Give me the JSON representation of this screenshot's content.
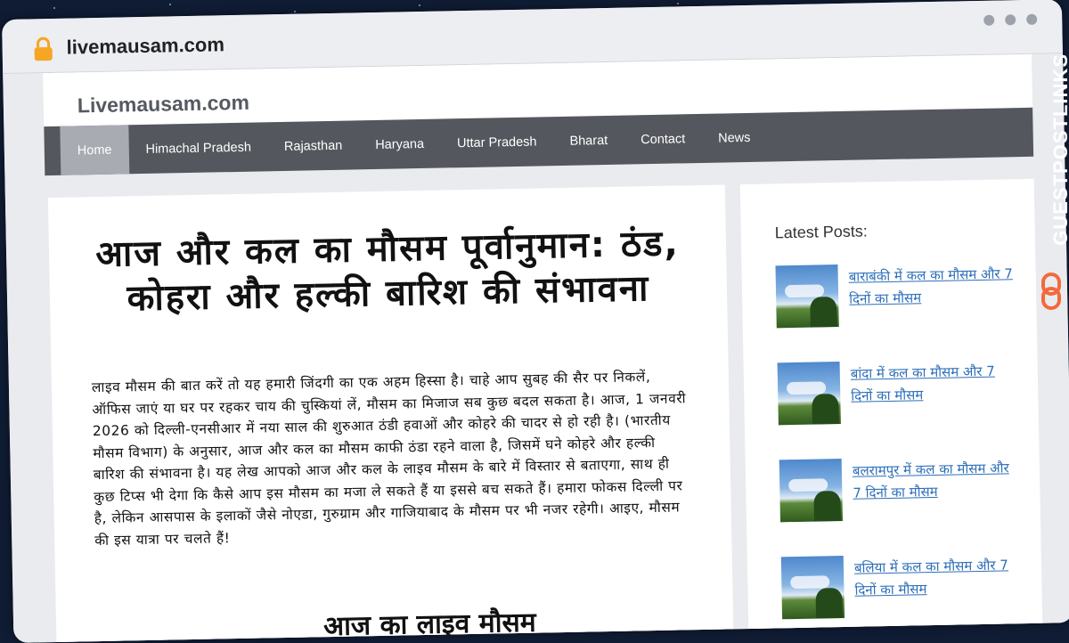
{
  "browser": {
    "url": "livemausam.com"
  },
  "site": {
    "title": "Livemausam.com"
  },
  "nav": {
    "items": [
      "Home",
      "Himachal Pradesh",
      "Rajasthan",
      "Haryana",
      "Uttar Pradesh",
      "Bharat",
      "Contact",
      "News"
    ],
    "active": "Home"
  },
  "post": {
    "title": "आज और कल का मौसम पूर्वानुमान: ठंड, कोहरा और हल्की बारिश की संभावना",
    "body": "लाइव मौसम की बात करें तो यह हमारी जिंदगी का एक अहम हिस्सा है। चाहे आप सुबह की सैर पर निकलें, ऑफिस जाएं या घर पर रहकर चाय की चुस्कियां लें, मौसम का मिजाज सब कुछ बदल सकता है। आज, 1 जनवरी 2026 को दिल्ली-एनसीआर में नया साल की शुरुआत ठंडी हवाओं और कोहरे की चादर से हो रही है। (भारतीय मौसम विभाग) के अनुसार, आज और कल का मौसम काफी ठंडा रहने वाला है, जिसमें घने कोहरे और हल्की बारिश की संभावना है। यह लेख आपको आज और कल के लाइव मौसम के बारे में विस्तार से बताएगा, साथ ही कुछ टिप्स भी देगा कि कैसे आप इस मौसम का मजा ले सकते हैं या इससे बच सकते हैं। हमारा फोकस दिल्ली पर है, लेकिन आसपास के इलाकों जैसे नोएडा, गुरुग्राम और गाजियाबाद के मौसम पर भी नजर रहेगी। आइए, मौसम की इस यात्रा पर चलते हैं!",
    "next_heading": "आज का लाइव मौसम"
  },
  "sidebar": {
    "heading": "Latest Posts:",
    "posts": [
      "बाराबंकी में कल का मौसम और 7 दिनों का मौसम",
      "बांदा में कल का मौसम और 7 दिनों का मौसम",
      "बलरामपुर में कल का मौसम और 7 दिनों का मौसम",
      "बलिया में कल का मौसम और 7 दिनों का मौसम"
    ]
  },
  "watermark": {
    "text": "GUESTPOSTLINKS"
  },
  "colors": {
    "nav_bg": "#55575e",
    "nav_active": "#a8abb2",
    "link": "#2d6fb8",
    "lock": "#f5a623",
    "watermark_logo": "#f26a3d"
  },
  "icons": {
    "lock": "padlock-icon",
    "window_controls": "three-dots-icon",
    "logo": "chain-link-icon"
  }
}
